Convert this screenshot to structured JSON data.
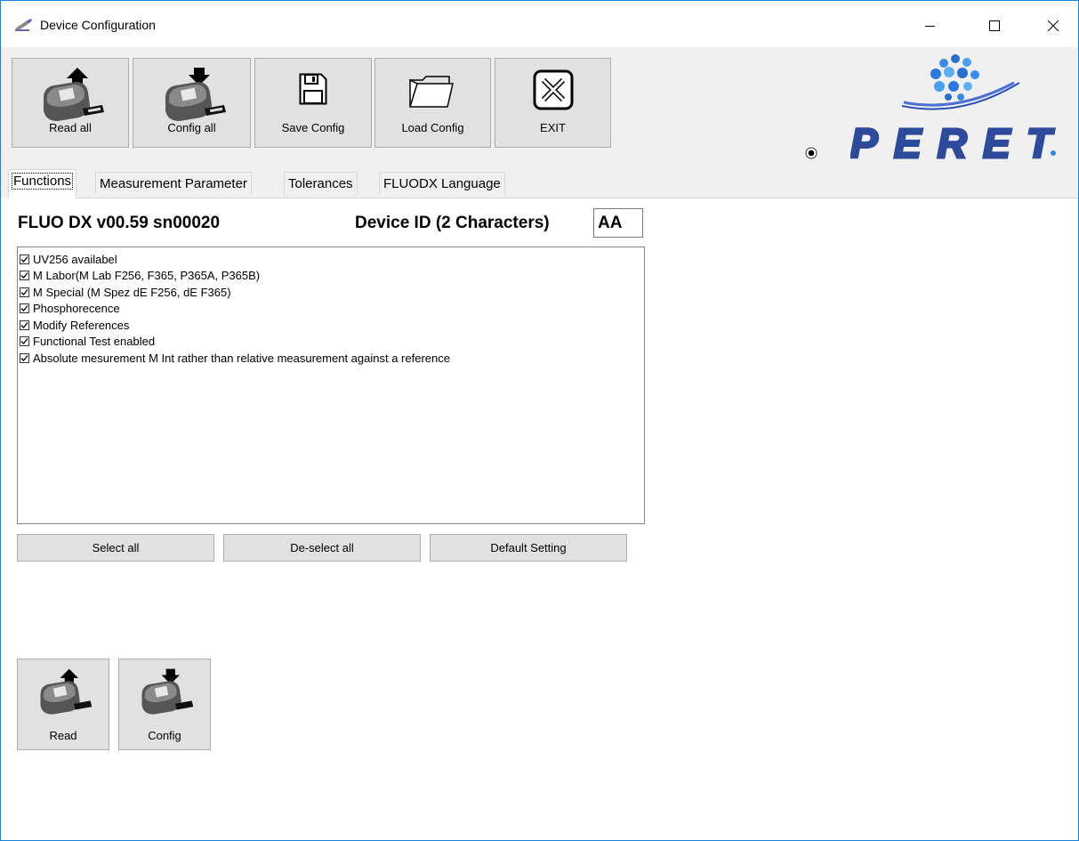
{
  "window": {
    "title": "Device Configuration"
  },
  "toolbar": {
    "read_all": "Read all",
    "config_all": "Config all",
    "save_config": "Save Config",
    "load_config": "Load Config",
    "exit": "EXIT"
  },
  "brand": {
    "logo_text": "PERET",
    "logo_color": "#2e4a9a"
  },
  "tabs": [
    {
      "label": "Functions",
      "active": true
    },
    {
      "label": "Measurement Parameter"
    },
    {
      "label": "Tolerances"
    },
    {
      "label": "FLUODX Language"
    }
  ],
  "functions": {
    "device_name": "FLUO DX v00.59 sn00020",
    "device_id_label": "Device ID (2 Characters)",
    "device_id_value": "AA",
    "items": [
      {
        "label": "UV256 availabel",
        "checked": true
      },
      {
        "label": "M Labor(M Lab F256, F365, P365A, P365B)",
        "checked": true
      },
      {
        "label": "M Special (M Spez dE F256, dE F365)",
        "checked": true
      },
      {
        "label": "Phosphorecence",
        "checked": true
      },
      {
        "label": "Modify References",
        "checked": true
      },
      {
        "label": "Functional Test enabled",
        "checked": true
      },
      {
        "label": "Absolute mesurement M Int rather than relative measurement against a reference",
        "checked": true
      }
    ],
    "select_all": "Select all",
    "deselect_all": "De-select all",
    "default_setting": "Default Setting",
    "read": "Read",
    "config": "Config"
  },
  "colors": {
    "window_border": "#1883d7",
    "button_face": "#e1e1e1",
    "toolbar_bg": "#f0f0f0"
  }
}
